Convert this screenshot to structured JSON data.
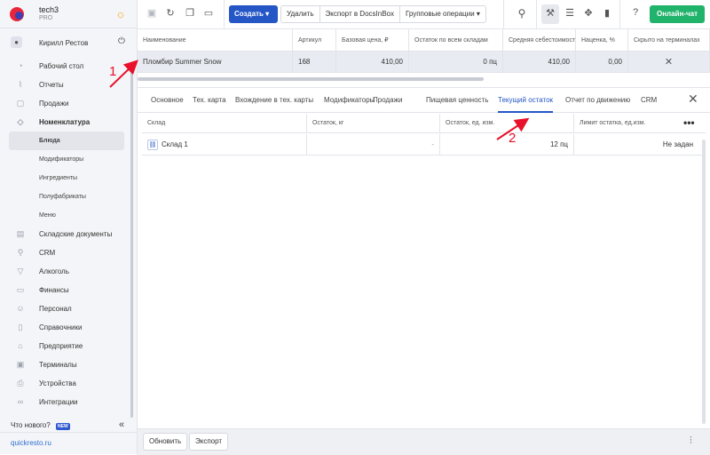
{
  "brand": {
    "name": "tech3",
    "plan": "PRO"
  },
  "user": {
    "name": "Кирилл Рестов"
  },
  "sidebar": {
    "items": [
      {
        "label": "Рабочий стол",
        "icon": "dashboard-icon",
        "glyph": "◔",
        "cls": ""
      },
      {
        "label": "Отчеты",
        "icon": "chart-icon",
        "glyph": "⌇",
        "cls": ""
      },
      {
        "label": "Продажи",
        "icon": "cart-icon",
        "glyph": "▢",
        "cls": ""
      },
      {
        "label": "Номенклатура",
        "icon": "tag-icon",
        "glyph": "◇",
        "cls": "bold"
      },
      {
        "label": "Блюда",
        "icon": "",
        "glyph": "",
        "cls": "sub active"
      },
      {
        "label": "Модификаторы",
        "icon": "",
        "glyph": "",
        "cls": "sub"
      },
      {
        "label": "Ингредиенты",
        "icon": "",
        "glyph": "",
        "cls": "sub"
      },
      {
        "label": "Полуфабрикаты",
        "icon": "",
        "glyph": "",
        "cls": "sub"
      },
      {
        "label": "Меню",
        "icon": "",
        "glyph": "",
        "cls": "sub"
      },
      {
        "label": "Складские документы",
        "icon": "warehouse-icon",
        "glyph": "▤",
        "cls": ""
      },
      {
        "label": "CRM",
        "icon": "crm-icon",
        "glyph": "⚲",
        "cls": ""
      },
      {
        "label": "Алкоголь",
        "icon": "glass-icon",
        "glyph": "▽",
        "cls": ""
      },
      {
        "label": "Финансы",
        "icon": "wallet-icon",
        "glyph": "▭",
        "cls": ""
      },
      {
        "label": "Персонал",
        "icon": "people-icon",
        "glyph": "☺",
        "cls": ""
      },
      {
        "label": "Справочники",
        "icon": "book-icon",
        "glyph": "▯",
        "cls": ""
      },
      {
        "label": "Предприятие",
        "icon": "building-icon",
        "glyph": "⌂",
        "cls": ""
      },
      {
        "label": "Терминалы",
        "icon": "terminal-icon",
        "glyph": "▣",
        "cls": ""
      },
      {
        "label": "Устройства",
        "icon": "printer-icon",
        "glyph": "⎙",
        "cls": ""
      },
      {
        "label": "Интеграции",
        "icon": "infinity-icon",
        "glyph": "∞",
        "cls": ""
      }
    ],
    "whats_new": "Что нового?",
    "new_badge": "NEW",
    "footer_link": "quickresto.ru"
  },
  "toolbar": {
    "create_label": "Создать ▾",
    "delete_label": "Удалить",
    "export_docs_label": "Экспорт в DocsInBox",
    "group_ops_label": "Групповые операции ▾",
    "chat_label": "Онлайн-чат"
  },
  "grid": {
    "headers": [
      "Наименование",
      "Артикул",
      "Базовая цена, ₽",
      "Остаток по всем складам",
      "Средняя себестоимость",
      "Наценка, %",
      "Скрыто на терминалах"
    ],
    "row": [
      "Пломбир Summer Snow",
      "168",
      "410,00",
      "0 пц",
      "410,00",
      "0,00",
      "✕"
    ]
  },
  "detail": {
    "tabs": [
      "Основное",
      "Тех. карта",
      "Вхождение в тех. карты",
      "Модификаторы",
      "Продажи",
      "Пищевая ценность",
      "Текущий остаток",
      "Отчет по движению",
      "CRM"
    ],
    "active_tab": 6,
    "stock_headers": [
      "Склад",
      "Остаток, кг",
      "Остаток, ед. изм.",
      "Лимит остатка, ед.изм."
    ],
    "stock_row": [
      "Склад 1",
      "-",
      "12 пц",
      "Не задан"
    ],
    "refresh_label": "Обновить",
    "export_label": "Экспорт"
  },
  "annotations": {
    "arrow1_label": "1",
    "arrow2_label": "2",
    "color": "#e8102a"
  }
}
